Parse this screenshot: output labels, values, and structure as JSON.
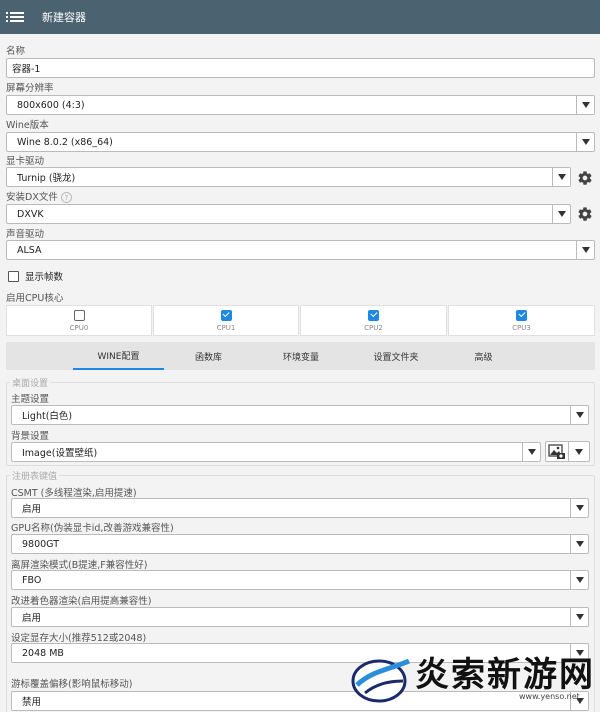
{
  "appbar": {
    "title": "新建容器",
    "menu_icon": "menu-icon"
  },
  "form": {
    "name_label": "名称",
    "name_value": "容器-1",
    "resolution_label": "屏幕分辨率",
    "resolution_value": "800x600 (4:3)",
    "wine_label": "Wine版本",
    "wine_value": "Wine 8.0.2 (x86_64)",
    "gpu_driver_label": "显卡驱动",
    "gpu_driver_value": "Turnip (骁龙)",
    "dx_label": "安装DX文件",
    "dx_help": "?",
    "dx_value": "DXVK",
    "audio_label": "声音驱动",
    "audio_value": "ALSA",
    "fps_label": "显示帧数",
    "fps_checked": false,
    "cpu_label": "启用CPU核心",
    "cpus": [
      {
        "name": "CPU0",
        "checked": false
      },
      {
        "name": "CPU1",
        "checked": true
      },
      {
        "name": "CPU2",
        "checked": true
      },
      {
        "name": "CPU3",
        "checked": true
      }
    ]
  },
  "tabs": [
    {
      "label": "WINE配置",
      "active": true
    },
    {
      "label": "函数库",
      "active": false
    },
    {
      "label": "环境变量",
      "active": false
    },
    {
      "label": "设置文件夹",
      "active": false
    },
    {
      "label": "高级",
      "active": false
    }
  ],
  "desktop": {
    "group_title": "桌面设置",
    "theme_label": "主题设置",
    "theme_value": "Light(白色)",
    "bg_label": "背景设置",
    "bg_value": "Image(设置壁纸)"
  },
  "registry": {
    "group_title": "注册表键值",
    "csmt_label": "CSMT (多线程渲染,启用提速)",
    "csmt_value": "启用",
    "gpu_name_label": "GPU名称(伪装显卡id,改善游戏兼容性)",
    "gpu_name_value": "9800GT",
    "offscreen_label": "离屏渲染模式(B提速,F兼容性好)",
    "offscreen_value": "FBO",
    "shader_label": "改进着色器渲染(启用提高兼容性)",
    "shader_value": "启用",
    "vram_label": "设定显存大小(推荐512或2048)",
    "vram_value": "2048 MB",
    "mouse_label": "游标覆盖偏移(影响鼠标移动)",
    "mouse_value": "禁用"
  },
  "watermark": {
    "text": "炎索新游网",
    "url": "www.yenso.net"
  },
  "colors": {
    "appbar": "#4b6270",
    "accent": "#1e88e5"
  }
}
